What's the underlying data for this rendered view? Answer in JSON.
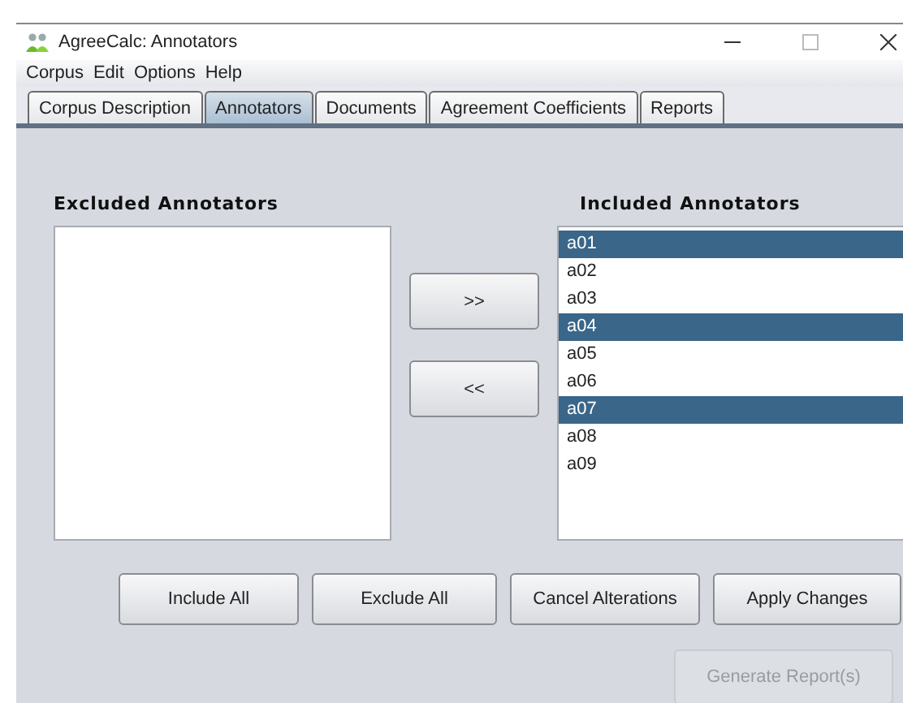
{
  "window": {
    "title": "AgreeCalc: Annotators"
  },
  "menu": [
    "Corpus",
    "Edit",
    "Options",
    "Help"
  ],
  "tabs": [
    {
      "label": "Corpus Description",
      "selected": false
    },
    {
      "label": "Annotators",
      "selected": true
    },
    {
      "label": "Documents",
      "selected": false
    },
    {
      "label": "Agreement Coefficients",
      "selected": false
    },
    {
      "label": "Reports",
      "selected": false
    }
  ],
  "excluded": {
    "title": "Excluded Annotators"
  },
  "transfer_buttons": [
    ">>",
    "<<"
  ],
  "included": {
    "title": "Included Annotators",
    "items": [
      {
        "label": "a01",
        "selected": true
      },
      {
        "label": "a02",
        "selected": false
      },
      {
        "label": "a03",
        "selected": false
      },
      {
        "label": "a04",
        "selected": true
      },
      {
        "label": "a05",
        "selected": false
      },
      {
        "label": "a06",
        "selected": false
      },
      {
        "label": "a07",
        "selected": true
      },
      {
        "label": "a08",
        "selected": false
      },
      {
        "label": "a09",
        "selected": false
      }
    ]
  },
  "actions": [
    "Include All",
    "Exclude All",
    "Cancel Alterations",
    "Apply Changes"
  ],
  "generate_button": {
    "label": "Generate Report(s)",
    "disabled": true
  }
}
